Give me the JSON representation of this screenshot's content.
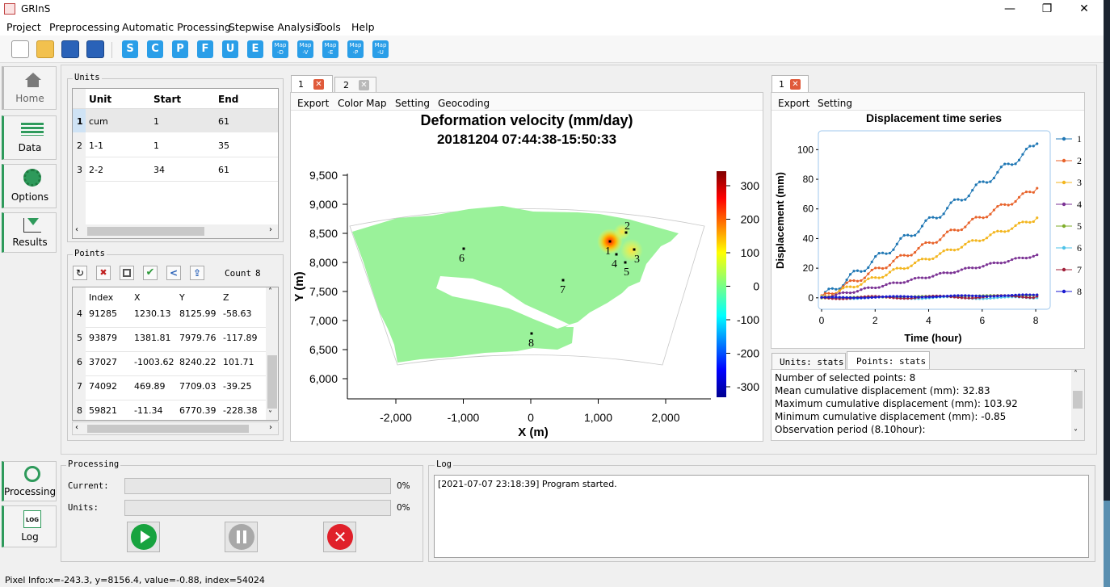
{
  "app": {
    "title": "GRInS",
    "window_controls": {
      "minimize": "—",
      "restore": "❐",
      "close": "✕"
    }
  },
  "menu": [
    "Project",
    "Preprocessing",
    "Automatic Processing",
    "Stepwise Analysis",
    "Tools",
    "Help"
  ],
  "toolbar": {
    "letters": [
      "S",
      "C",
      "P",
      "F",
      "U",
      "E"
    ],
    "maps": [
      {
        "t": "Map",
        "b": "-D"
      },
      {
        "t": "Map",
        "b": "-V"
      },
      {
        "t": "Map",
        "b": "-E"
      },
      {
        "t": "Map",
        "b": "-P"
      },
      {
        "t": "Map",
        "b": "-U"
      }
    ]
  },
  "sidebar": {
    "home": "Home",
    "data": "Data",
    "options": "Options",
    "results": "Results",
    "processing": "Processing",
    "log": "Log",
    "log_icon": "LOG"
  },
  "units": {
    "title": "Units",
    "headers": [
      "Unit",
      "Start",
      "End"
    ],
    "rows": [
      [
        "1",
        "cum",
        "1",
        "61"
      ],
      [
        "2",
        "1-1",
        "1",
        "35"
      ],
      [
        "3",
        "2-2",
        "34",
        "61"
      ]
    ]
  },
  "points": {
    "title": "Points",
    "count_label": "Count",
    "count": "8",
    "headers": [
      "Index",
      "X",
      "Y",
      "Z"
    ],
    "rows": [
      [
        "4",
        "91285",
        "1230.13",
        "8125.99",
        "-58.63"
      ],
      [
        "5",
        "93879",
        "1381.81",
        "7979.76",
        "-117.89"
      ],
      [
        "6",
        "37027",
        "-1003.62",
        "8240.22",
        "101.71"
      ],
      [
        "7",
        "74092",
        "469.89",
        "7709.03",
        "-39.25"
      ],
      [
        "8",
        "59821",
        "-11.34",
        "6770.39",
        "-228.38"
      ]
    ]
  },
  "map_panel": {
    "tabs": [
      "1",
      "2"
    ],
    "menu": [
      "Export",
      "Color Map",
      "Setting",
      "Geocoding"
    ],
    "title1": "Deformation velocity (mm/day)",
    "title2": "20181204 07:44:38-15:50:33",
    "xlabel": "X (m)",
    "ylabel": "Y (m)",
    "yticks": [
      "9,500",
      "9,000",
      "8,500",
      "8,000",
      "7,500",
      "7,000",
      "6,500",
      "6,000"
    ],
    "xticks": [
      "-2,000",
      "-1,000",
      "0",
      "1,000",
      "2,000"
    ],
    "cticks": [
      "300",
      "200",
      "100",
      "0",
      "-100",
      "-200",
      "-300"
    ],
    "point_labels": [
      "1",
      "2",
      "3",
      "4",
      "5",
      "6",
      "7",
      "8"
    ]
  },
  "ts_panel": {
    "tab": "1",
    "menu": [
      "Export",
      "Setting"
    ]
  },
  "stats": {
    "tabs": [
      "Units: stats",
      "Points: stats"
    ],
    "lines": [
      "Number of selected points: 8",
      "Mean cumulative displacement (mm): 32.83",
      "Maximum cumulative displacement (mm): 103.92",
      "Minimum cumulative displacement (mm): -0.85",
      "Observation period (8.10hour):"
    ]
  },
  "processing": {
    "title": "Processing",
    "current_label": "Current:",
    "units_label": "Units:",
    "current_pct": "0%",
    "units_pct": "0%",
    "current_value": 0,
    "units_value": 0
  },
  "log": {
    "title": "Log",
    "lines": [
      "[2021-07-07 23:18:39]  Program started."
    ]
  },
  "status": "Pixel Info:x=-243.3, y=8156.4, value=-0.88, index=54024",
  "chart_data": {
    "type": "line",
    "title": "Displacement time series",
    "xlabel": "Time (hour)",
    "ylabel": "Displacement (mm)",
    "xlim": [
      0,
      8.3
    ],
    "ylim": [
      -5,
      110
    ],
    "xticks": [
      0,
      2,
      4,
      6,
      8
    ],
    "yticks": [
      0,
      20,
      40,
      60,
      80,
      100
    ],
    "legend": "right",
    "grid": false,
    "series": [
      {
        "name": "1",
        "color": "#1f77b4",
        "end": 104
      },
      {
        "name": "2",
        "color": "#e8632b",
        "end": 74
      },
      {
        "name": "3",
        "color": "#f3b61f",
        "end": 54
      },
      {
        "name": "4",
        "color": "#7b3294",
        "end": 29
      },
      {
        "name": "5",
        "color": "#7fae2b",
        "end": 2
      },
      {
        "name": "6",
        "color": "#4fc3e8",
        "end": 0
      },
      {
        "name": "7",
        "color": "#a0203a",
        "end": 1
      },
      {
        "name": "8",
        "color": "#1a1ad0",
        "end": 2
      }
    ]
  }
}
